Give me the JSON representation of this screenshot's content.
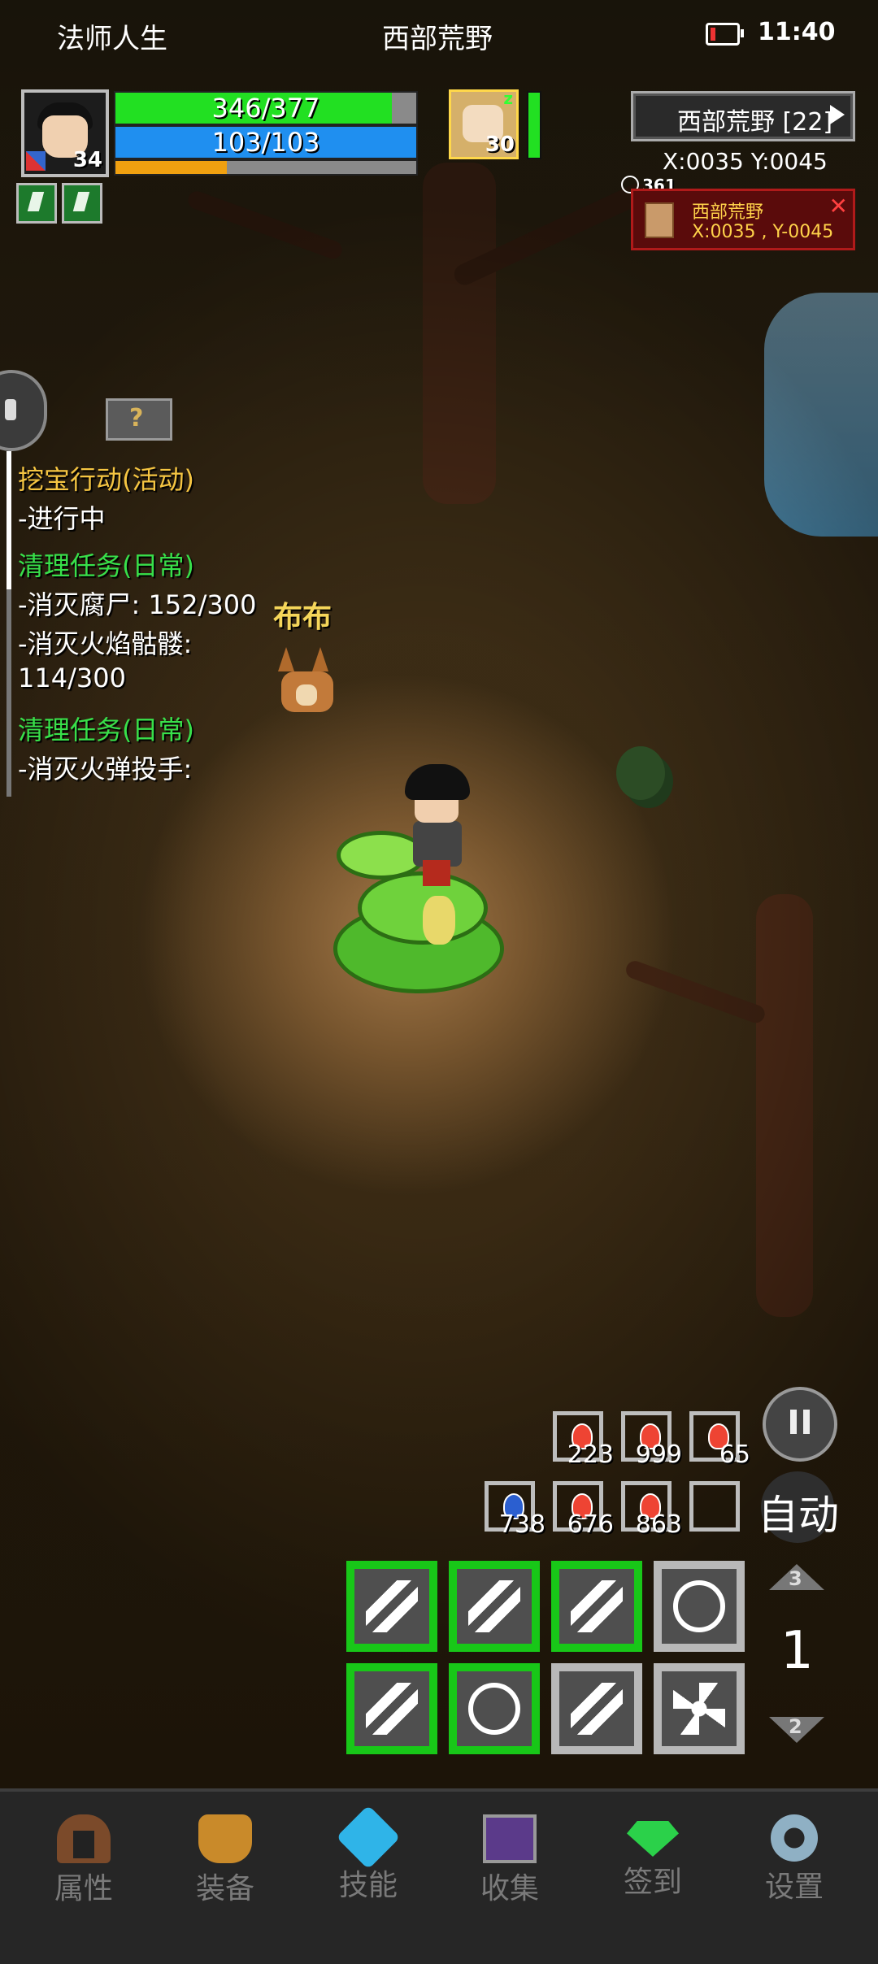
{
  "status_bar": {
    "app_name": "法师人生",
    "location": "西部荒野",
    "time": "11:40"
  },
  "player": {
    "level": "34",
    "hp_text": "346/377",
    "hp_fraction": 0.918,
    "mp_text": "103/103",
    "mp_fraction": 1.0,
    "xp_fraction": 0.37
  },
  "pet_hud": {
    "level": "30",
    "status": "z"
  },
  "map": {
    "button_label": "西部荒野 [22]",
    "coords": "X:0035  Y:0045",
    "popup_timer": "361",
    "popup_title": "西部荒野",
    "popup_coords": "X:0035 , Y-0045",
    "close_symbol": "✕"
  },
  "help_symbol": "?",
  "quests": [
    {
      "text": "挖宝行动(活动)",
      "color": "yellow"
    },
    {
      "text": "-进行中",
      "color": "white"
    },
    {
      "text": "清理任务(日常)",
      "color": "green"
    },
    {
      "text": "-消灭腐尸: 152/300",
      "color": "white"
    },
    {
      "text": "-消灭火焰骷髅:",
      "color": "white"
    },
    {
      "text": "114/300",
      "color": "white"
    },
    {
      "text": "清理任务(日常)",
      "color": "green"
    },
    {
      "text": "-消灭火弹投手:",
      "color": "white"
    }
  ],
  "pet_name": "布布",
  "potions": {
    "row1": [
      {
        "count": "223",
        "type": "red-potion-icon"
      },
      {
        "count": "999",
        "type": "red-potion-icon"
      },
      {
        "count": "65",
        "type": "red-potion-icon"
      }
    ],
    "row2": [
      {
        "count": "738",
        "type": "blue-potion-icon"
      },
      {
        "count": "676",
        "type": "red-potion-icon"
      },
      {
        "count": "863",
        "type": "red-potion-icon"
      },
      {
        "count": "",
        "type": "empty-slot"
      }
    ]
  },
  "controls": {
    "auto_label": "自动",
    "page_current": "1",
    "page_up": "3",
    "page_down": "2"
  },
  "skills": [
    {
      "icon": "sword-slash-icon",
      "active": true
    },
    {
      "icon": "dash-strike-icon",
      "active": true
    },
    {
      "icon": "claw-slash-icon",
      "active": true
    },
    {
      "icon": "burst-ring-icon",
      "active": false
    },
    {
      "icon": "claw-slash-icon",
      "active": true
    },
    {
      "icon": "swirl-ring-icon",
      "active": true
    },
    {
      "icon": "spear-throw-icon",
      "active": false
    },
    {
      "icon": "star-burst-icon",
      "active": false
    }
  ],
  "nav": [
    {
      "label": "属性",
      "icon": "helmet-icon"
    },
    {
      "label": "装备",
      "icon": "bag-icon"
    },
    {
      "label": "技能",
      "icon": "skill-gem-icon"
    },
    {
      "label": "收集",
      "icon": "book-icon"
    },
    {
      "label": "签到",
      "icon": "diamond-icon"
    },
    {
      "label": "设置",
      "icon": "gear-icon"
    }
  ],
  "colors": {
    "hp": "#22e022",
    "mp": "#1f8ff0",
    "xp": "#f0a010",
    "quest_yellow": "#f5c542",
    "quest_green": "#38e04a",
    "skill_active_border": "#18c718",
    "skill_inactive_border": "#b8b8b8"
  }
}
